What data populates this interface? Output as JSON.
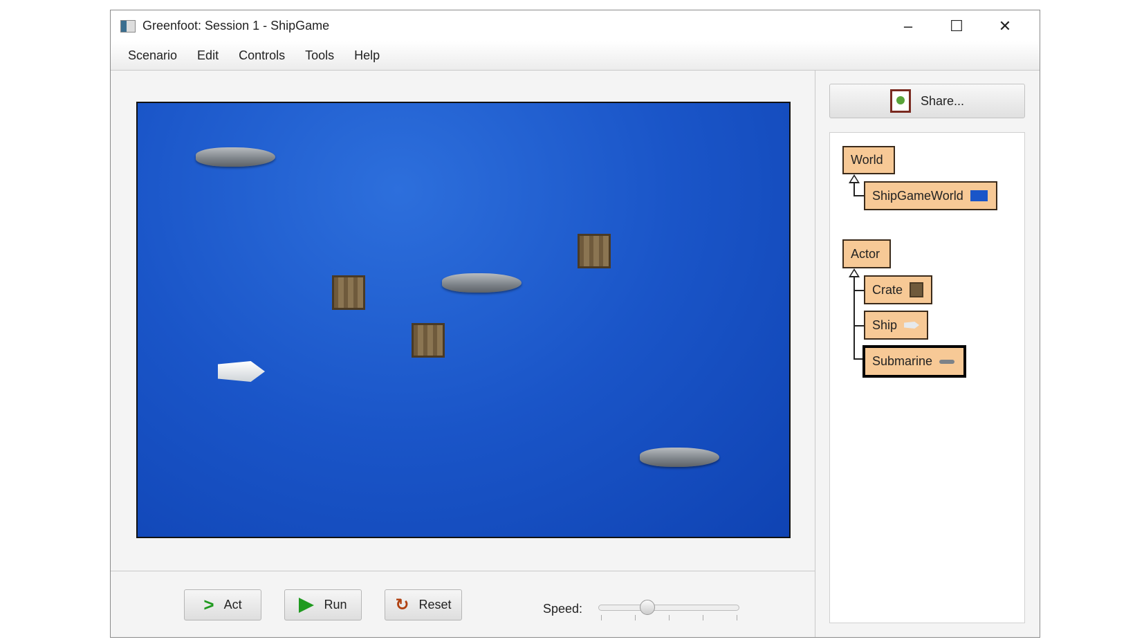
{
  "window": {
    "title": "Greenfoot: Session 1 - ShipGame",
    "minimize": "–",
    "maximize": "☐",
    "close": "✕"
  },
  "menu": [
    "Scenario",
    "Edit",
    "Controls",
    "Tools",
    "Help"
  ],
  "controls": {
    "act": "Act",
    "run": "Run",
    "reset": "Reset",
    "speed_label": "Speed:",
    "speed_value": 0.35
  },
  "share": {
    "label": "Share..."
  },
  "classes": {
    "world": "World",
    "shipgameworld": "ShipGameWorld",
    "actor": "Actor",
    "crate": "Crate",
    "ship": "Ship",
    "submarine": "Submarine",
    "selected": "Submarine"
  },
  "colors": {
    "class_box": "#f7c996",
    "ocean": "#1a55c8",
    "run_green": "#1f9a1f"
  }
}
